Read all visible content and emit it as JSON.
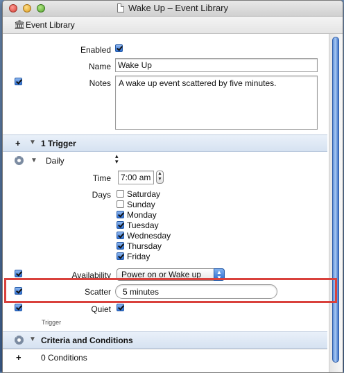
{
  "window": {
    "title": "Wake Up – Event Library"
  },
  "pathbar": {
    "label": "Event Library",
    "icon": "library-icon"
  },
  "event": {
    "enabled_label": "Enabled",
    "enabled": true,
    "name_label": "Name",
    "name_value": "Wake Up",
    "notes_label": "Notes",
    "notes_value": "A wake up event scattered by five minutes.",
    "notes_checked": true
  },
  "trigger_section": {
    "add_label": "+",
    "title": "1 Trigger",
    "type_value": "Daily",
    "time_label": "Time",
    "time_value": "7:00 am",
    "days_label": "Days",
    "days": [
      {
        "label": "Saturday",
        "checked": false
      },
      {
        "label": "Sunday",
        "checked": false
      },
      {
        "label": "Monday",
        "checked": true
      },
      {
        "label": "Tuesday",
        "checked": true
      },
      {
        "label": "Wednesday",
        "checked": true
      },
      {
        "label": "Thursday",
        "checked": true
      },
      {
        "label": "Friday",
        "checked": true
      }
    ],
    "availability_label": "Availability",
    "availability_value": "Power on or Wake up",
    "availability_checked": true,
    "scatter_label": "Scatter",
    "scatter_value": "5 minutes",
    "scatter_checked": true,
    "quiet_label": "Quiet",
    "quiet_checked": true,
    "quiet_enabled": true,
    "footer_label": "Trigger"
  },
  "criteria_section": {
    "title": "Criteria and Conditions",
    "add_label": "+",
    "conditions_count": "0 Conditions"
  },
  "colors": {
    "highlight": "#d9413c",
    "section_bg": "#dfe8f4",
    "checkbox_on": "#2e6fd2"
  }
}
